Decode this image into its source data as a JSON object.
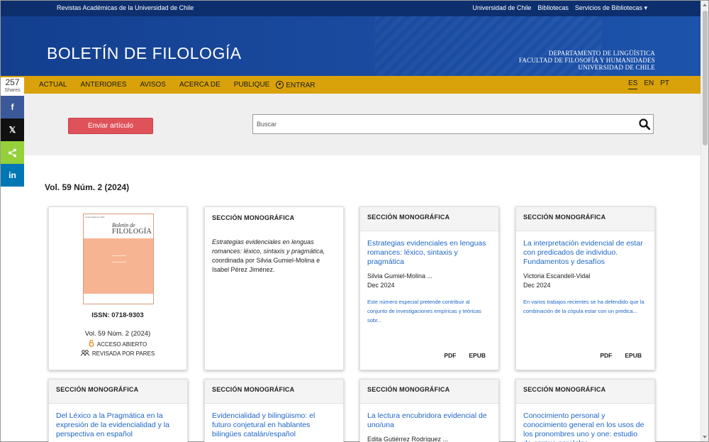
{
  "topbar": {
    "left": "Revistas Académicas de la Universidad de Chile",
    "links": [
      "Universidad de Chile",
      "Bibliotecas",
      "Servicios de Bibliotecas ▾"
    ]
  },
  "header": {
    "brand": "BOLETÍN DE FILOLOGÍA",
    "dept_lines": [
      "DEPARTAMENTO DE LINGÜÍSTICA",
      "FACULTAD DE FILOSOFÍA Y HUMANIDADES",
      "UNIVERSIDAD DE CHILE"
    ]
  },
  "nav": {
    "items": [
      "ACTUAL",
      "ANTERIORES",
      "AVISOS",
      "ACERCA DE",
      "PUBLIQUE"
    ],
    "login": "ENTRAR",
    "langs": [
      "ES",
      "EN",
      "PT"
    ],
    "active_lang": "ES"
  },
  "share": {
    "count": "257",
    "label": "Shares",
    "buttons": [
      {
        "glyph": "f",
        "color": "#3b5998",
        "name": "facebook"
      },
      {
        "glyph": "𝕏",
        "color": "#111111",
        "name": "x"
      },
      {
        "glyph": "⋖",
        "color": "#95d03a",
        "name": "share"
      },
      {
        "glyph": "in",
        "color": "#0077b5",
        "name": "linkedin"
      }
    ]
  },
  "submit_button": "Enviar artículo",
  "search": {
    "placeholder": "Buscar"
  },
  "issue_title": "Vol. 59 Núm. 2 (2024)",
  "cover_card": {
    "cover_top": "Universidad de Chile",
    "cover_small": "Boletín de",
    "cover_big": "FILOLOGÍA",
    "issn": "ISSN: 0718-9303",
    "issue": "Vol. 59 Núm. 2 (2024)",
    "open_access": "ACCESO ABIERTO",
    "peer_review": "REVISADA POR PARES"
  },
  "intro_card": {
    "section": "SECCIÓN MONOGRÁFICA",
    "italic": "Estrategias evidenciales en lenguas romances: léxico, sintaxis y pragmática,",
    "rest": " coordinada por Silvia Gumiel-Molina e Isabel Pérez Jiménez."
  },
  "articles": [
    {
      "section": "SECCIÓN MONOGRÁFICA",
      "title": "Estrategias evidenciales en lenguas romances: léxico, sintaxis y pragmática",
      "author": "Silvia Gumiel-Molina ...",
      "date": "Dec 2024",
      "abstract": "Este número especial pretende contribuir al conjunto de investigaciones empíricas y teóricas sobr...",
      "pdf": "PDF",
      "epub": "EPUB"
    },
    {
      "section": "SECCIÓN MONOGRÁFICA",
      "title": "La interpretación evidencial de estar con predicados de individuo. Fundamentos y desafíos",
      "author": "Victoria Escandell-Vidal",
      "date": "Dec 2024",
      "abstract": "En varios trabajos recientes se ha defendido que la combinación de la cópula estar con un predica...",
      "pdf": "PDF",
      "epub": "EPUB"
    },
    {
      "section": "SECCIÓN MONOGRÁFICA",
      "title": "Del Léxico a la Pragmática en la expresión de la evidencialidad y la perspectiva en español",
      "author": "",
      "date": "",
      "abstract": ""
    },
    {
      "section": "SECCIÓN MONOGRÁFICA",
      "title": "Evidencialidad y bilingüismo: el futuro conjetural en hablantes bilingües catalán/español",
      "author": "",
      "date": "",
      "abstract": ""
    },
    {
      "section": "SECCIÓN MONOGRÁFICA",
      "title": "La lectura encubridora evidencial de uno/una",
      "author": "Edita Gutiérrez Rodríguez ...",
      "date": "",
      "abstract": ""
    },
    {
      "section": "SECCIÓN MONOGRÁFICA",
      "title": "Conocimiento personal y conocimiento general en los usos de los pronombres uno y one: estudio de corpus paralelos",
      "author": "",
      "date": "",
      "abstract": ""
    }
  ]
}
